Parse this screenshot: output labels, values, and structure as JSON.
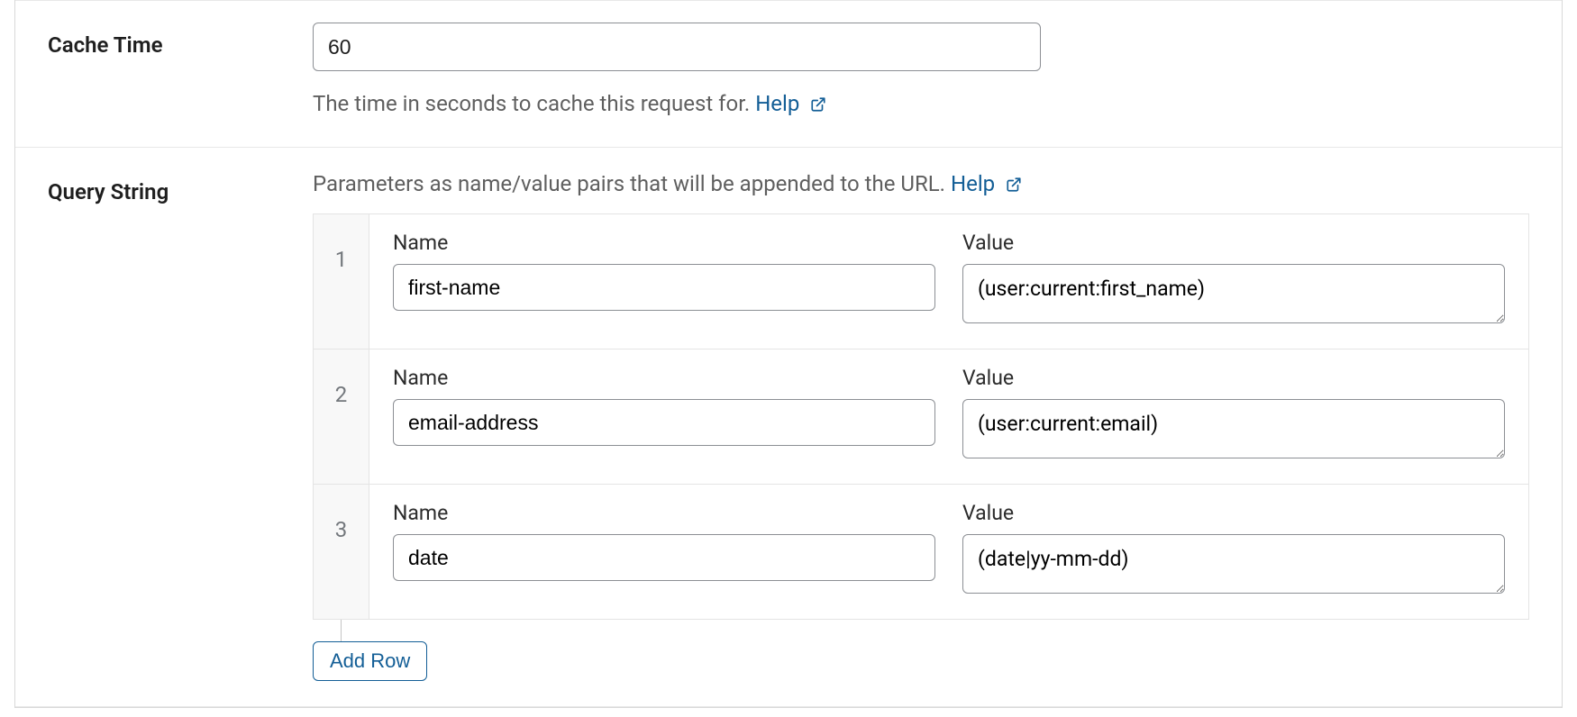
{
  "cache": {
    "label": "Cache Time",
    "value": "60",
    "desc_text": "The time in seconds to cache this request for. ",
    "help_label": "Help"
  },
  "query": {
    "label": "Query String",
    "desc_text": "Parameters as name/value pairs that will be appended to the URL. ",
    "help_label": "Help",
    "name_header": "Name",
    "value_header": "Value",
    "add_row_label": "Add Row",
    "rows": [
      {
        "num": "1",
        "name": "first-name",
        "value": "(user:current:first_name)"
      },
      {
        "num": "2",
        "name": "email-address",
        "value": "(user:current:email)"
      },
      {
        "num": "3",
        "name": "date",
        "value": "(date|yy-mm-dd)"
      }
    ]
  }
}
